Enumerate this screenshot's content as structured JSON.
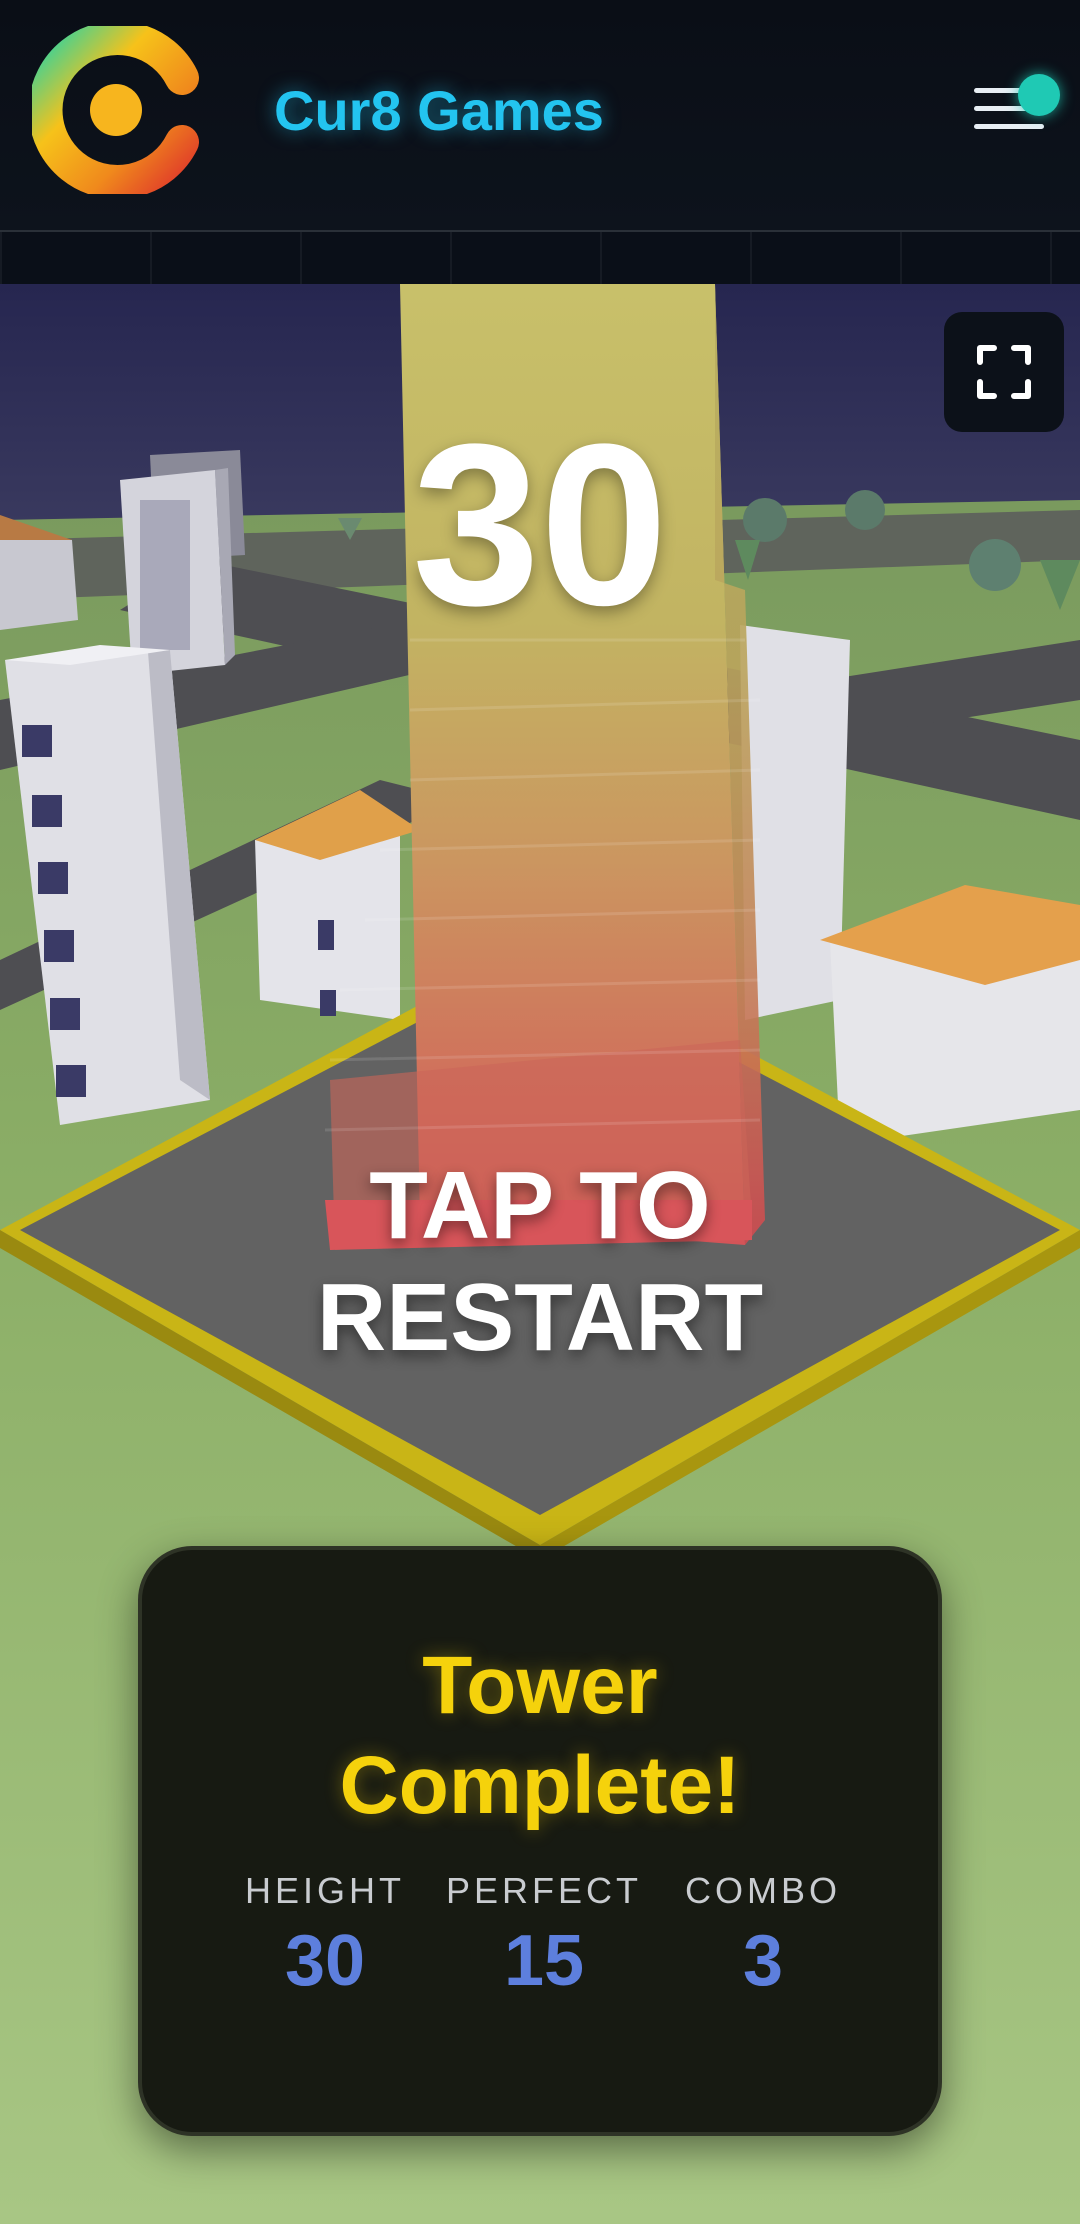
{
  "header": {
    "brand": "Cur8 Games"
  },
  "game": {
    "score": "30",
    "restart_line1": "TAP TO",
    "restart_line2": "RESTART"
  },
  "result_panel": {
    "title_line1": "Tower",
    "title_line2": "Complete!",
    "stats": [
      {
        "label": "HEIGHT",
        "value": "30"
      },
      {
        "label": "PERFECT",
        "value": "15"
      },
      {
        "label": "COMBO",
        "value": "3"
      }
    ]
  },
  "colors": {
    "brand": "#23c4f0",
    "title": "#f5d20c",
    "stat_value": "#5d7fdd",
    "notification_dot": "#1fc9b4"
  },
  "icons": {
    "logo": "cur8-logo",
    "menu": "hamburger-menu-icon",
    "fullscreen": "fullscreen-icon"
  }
}
